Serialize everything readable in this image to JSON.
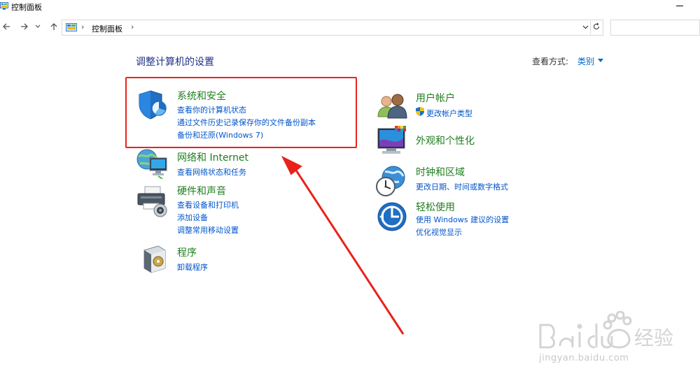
{
  "window": {
    "title": "控制面板"
  },
  "nav": {
    "back_icon": "back-arrow-icon",
    "forward_icon": "forward-arrow-icon",
    "up_icon": "up-arrow-icon",
    "breadcrumb_sep": "›",
    "breadcrumb_item": "控制面板",
    "breadcrumb_sep_end": "›"
  },
  "main": {
    "title": "调整计算机的设置",
    "view_by_label": "查看方式:",
    "view_by_value": "类别"
  },
  "left_categories": [
    {
      "title": "系统和安全",
      "links": [
        "查看你的计算机状态",
        "通过文件历史记录保存你的文件备份副本",
        "备份和还原(Windows 7)"
      ]
    },
    {
      "title": "网络和 Internet",
      "links": [
        "查看网络状态和任务"
      ]
    },
    {
      "title": "硬件和声音",
      "links": [
        "查看设备和打印机",
        "添加设备",
        "调整常用移动设置"
      ]
    },
    {
      "title": "程序",
      "links": [
        "卸载程序"
      ]
    }
  ],
  "right_categories": [
    {
      "title": "用户帐户",
      "links": [
        "更改帐户类型"
      ]
    },
    {
      "title": "外观和个性化",
      "links": []
    },
    {
      "title": "时钟和区域",
      "links": [
        "更改日期、时间或数字格式"
      ]
    },
    {
      "title": "轻松使用",
      "links": [
        "使用 Windows 建议的设置",
        "优化视觉显示"
      ]
    }
  ],
  "watermark": {
    "text": "jingyan.baidu.com"
  },
  "colors": {
    "category_title": "#1e7e1e",
    "link": "#0055cc",
    "highlight": "#e8231c"
  }
}
